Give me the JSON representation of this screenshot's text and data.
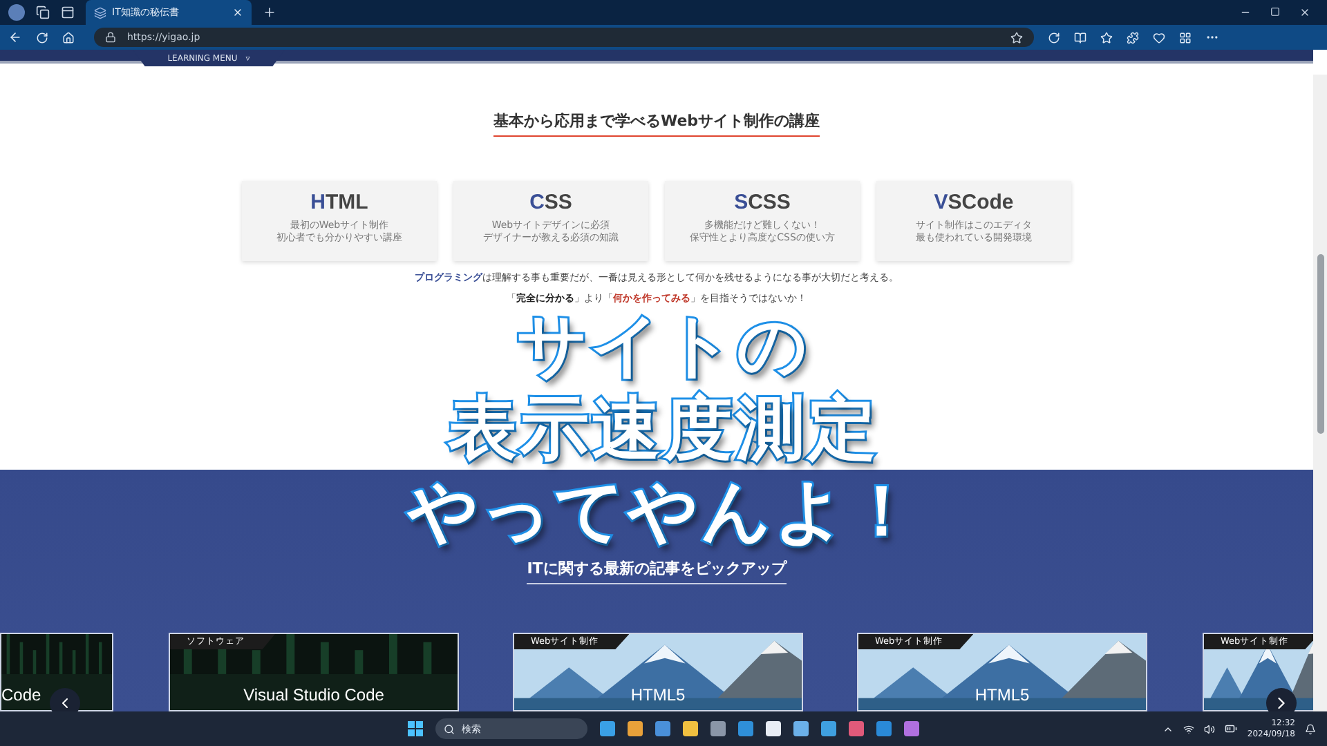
{
  "browser": {
    "tab": {
      "title": "IT知識の秘伝書",
      "selected": true
    },
    "address": "https://yigao.jp"
  },
  "nav": {
    "menu_label": "LEARNING MENU",
    "menu_caret": "▿"
  },
  "intro": {
    "heading": "基本から応用まで学べるWebサイト制作の講座",
    "courses": [
      {
        "initial": "H",
        "rest": "TML",
        "lines": [
          "最初のWebサイト制作",
          "初心者でも分かりやすい講座"
        ]
      },
      {
        "initial": "C",
        "rest": "SS",
        "lines": [
          "Webサイトデザインに必須",
          "デザイナーが教える必須の知識"
        ]
      },
      {
        "initial": "S",
        "rest": "CSS",
        "lines": [
          "多機能だけど難しくない！",
          "保守性とより高度なCSSの使い方"
        ]
      },
      {
        "initial": "V",
        "rest": "SCode",
        "lines": [
          "サイト制作はこのエディタ",
          "最も使われている開発環境"
        ]
      }
    ],
    "paragraphs": [
      [
        {
          "text": "プログラミング",
          "kind": "accent"
        },
        {
          "text": "は理解する事も重要だが、一番は見える形として何かを残せるようになる事が大切だと考える。",
          "kind": "plain"
        }
      ],
      [
        {
          "text": "「",
          "kind": "plain"
        },
        {
          "text": "完全に分かる",
          "kind": "bold"
        },
        {
          "text": "」より「",
          "kind": "plain"
        },
        {
          "text": "何かを作ってみる",
          "kind": "warm"
        },
        {
          "text": "」を目指そうではないか！",
          "kind": "plain"
        }
      ]
    ]
  },
  "articles": {
    "heading": "ITに関する最新の記事をピックアップ",
    "cards": [
      {
        "kind": "software",
        "title": "Code"
      },
      {
        "kind": "software",
        "tag": "ソフトウェア",
        "title": "Visual Studio Code"
      },
      {
        "kind": "web",
        "tag": "Webサイト制作",
        "title": "HTML5"
      },
      {
        "kind": "web",
        "tag": "Webサイト制作",
        "title": "HTML5"
      },
      {
        "kind": "web",
        "tag": "Webサイト制作"
      }
    ]
  },
  "overlay": [
    "サイトの",
    "表示速度測定",
    "やってやんよ！"
  ],
  "taskbar": {
    "search_placeholder": "検索",
    "time": "12:32",
    "date": "2024/09/18"
  }
}
